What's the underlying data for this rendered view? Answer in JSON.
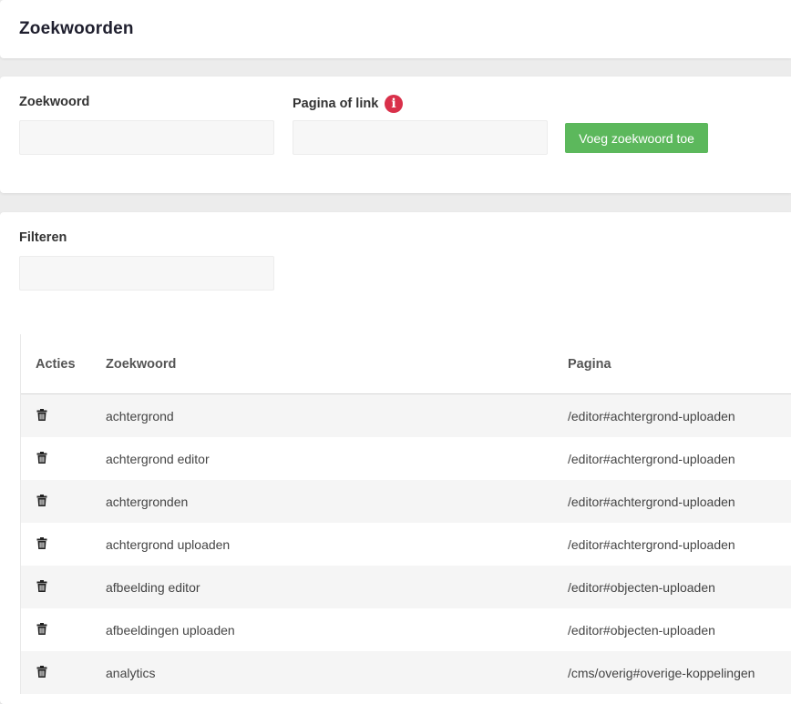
{
  "header": {
    "title": "Zoekwoorden"
  },
  "form": {
    "keyword_label": "Zoekwoord",
    "keyword_value": "",
    "page_label": "Pagina of link",
    "page_value": "",
    "info_icon": "info-icon",
    "add_button_label": "Voeg zoekwoord toe"
  },
  "filter": {
    "label": "Filteren",
    "value": ""
  },
  "table": {
    "columns": [
      "Acties",
      "Zoekwoord",
      "Pagina"
    ],
    "row_action_icon": "trash-icon",
    "rows": [
      {
        "keyword": "achtergrond",
        "page": "/editor#achtergrond-uploaden"
      },
      {
        "keyword": "achtergrond editor",
        "page": "/editor#achtergrond-uploaden"
      },
      {
        "keyword": "achtergronden",
        "page": "/editor#achtergrond-uploaden"
      },
      {
        "keyword": "achtergrond uploaden",
        "page": "/editor#achtergrond-uploaden"
      },
      {
        "keyword": "afbeelding editor",
        "page": "/editor#objecten-uploaden"
      },
      {
        "keyword": "afbeeldingen uploaden",
        "page": "/editor#objecten-uploaden"
      },
      {
        "keyword": "analytics",
        "page": "/cms/overig#overige-koppelingen"
      }
    ]
  },
  "colors": {
    "accent_green": "#5cb85c",
    "info_red": "#d9304a",
    "title_text": "#1f1f2e"
  }
}
